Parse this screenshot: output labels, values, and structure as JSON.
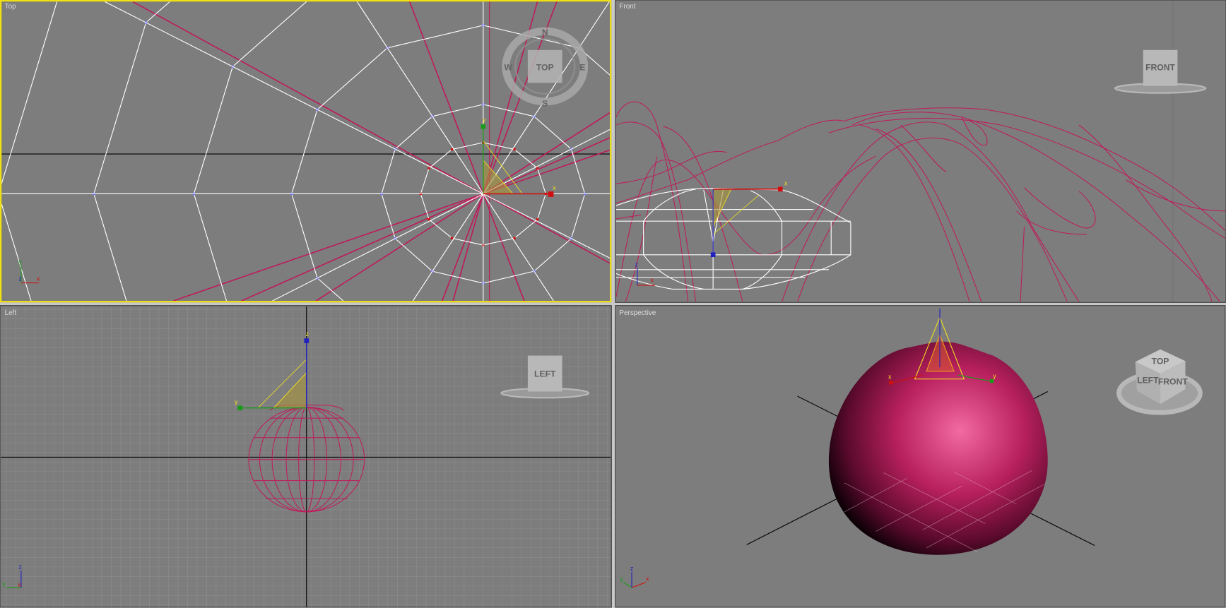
{
  "viewports": {
    "top": {
      "label": "Top",
      "cube": "TOP",
      "compass": {
        "n": "N",
        "s": "S",
        "e": "E",
        "w": "W"
      },
      "active": true
    },
    "front": {
      "label": "Front",
      "cube": "FRONT"
    },
    "left": {
      "label": "Left",
      "cube": "LEFT"
    },
    "perspective": {
      "label": "Perspective",
      "cube_top": "TOP",
      "cube_left": "LEFT",
      "cube_front": "FRONT"
    }
  },
  "axes": {
    "x": "x",
    "y": "y",
    "z": "z"
  },
  "colors": {
    "viewport_bg": "#7d7d7d",
    "active_border": "#f0e010",
    "wire_pink": "#c0185a",
    "wire_white": "#ffffff",
    "gizmo_yellow": "#f0e020",
    "sphere": "#e0307a"
  }
}
